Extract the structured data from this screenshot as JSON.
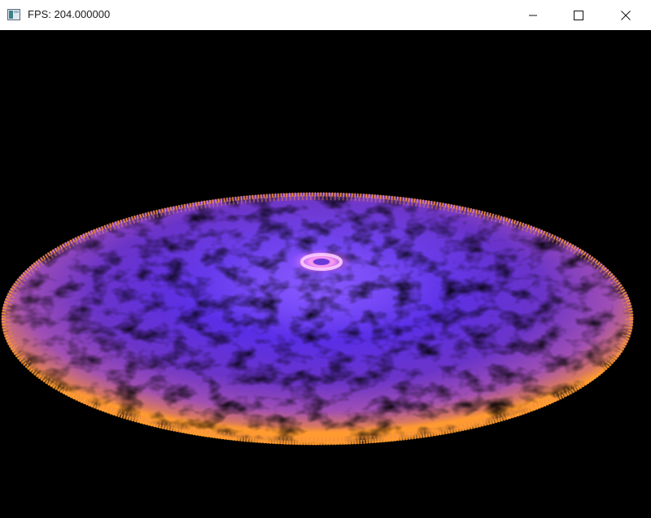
{
  "window": {
    "title": "FPS: 204.000000",
    "icon": "app-window-icon",
    "controls": {
      "minimize_icon": "minimize-icon",
      "maximize_icon": "maximize-icon",
      "close_icon": "close-icon"
    }
  },
  "scene": {
    "background_color": "#000000",
    "object": "galaxy-particle-disc",
    "colors": {
      "core": "#ffd0ff",
      "inner": "#5a2cff",
      "mid": "#7a3fe0",
      "outer": "#c060c0",
      "rim": "#ff9a30"
    }
  }
}
